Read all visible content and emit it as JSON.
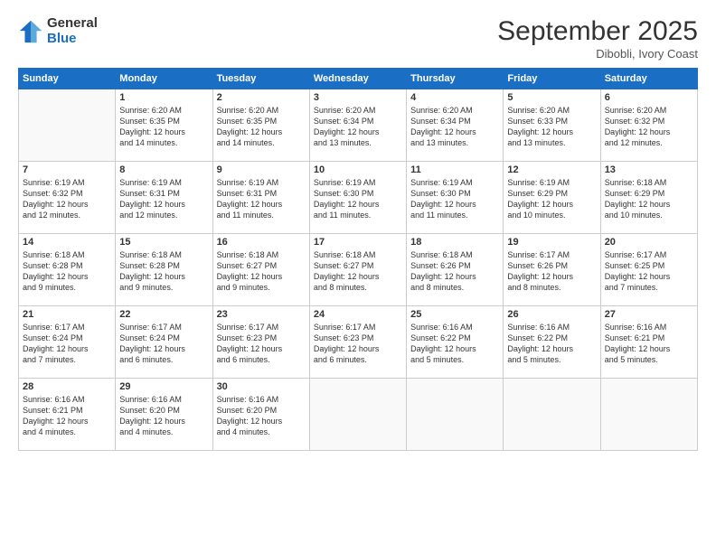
{
  "logo": {
    "general": "General",
    "blue": "Blue"
  },
  "header": {
    "title": "September 2025",
    "subtitle": "Dibobli, Ivory Coast"
  },
  "days_of_week": [
    "Sunday",
    "Monday",
    "Tuesday",
    "Wednesday",
    "Thursday",
    "Friday",
    "Saturday"
  ],
  "weeks": [
    [
      {
        "day": "",
        "info": ""
      },
      {
        "day": "1",
        "info": "Sunrise: 6:20 AM\nSunset: 6:35 PM\nDaylight: 12 hours\nand 14 minutes."
      },
      {
        "day": "2",
        "info": "Sunrise: 6:20 AM\nSunset: 6:35 PM\nDaylight: 12 hours\nand 14 minutes."
      },
      {
        "day": "3",
        "info": "Sunrise: 6:20 AM\nSunset: 6:34 PM\nDaylight: 12 hours\nand 13 minutes."
      },
      {
        "day": "4",
        "info": "Sunrise: 6:20 AM\nSunset: 6:34 PM\nDaylight: 12 hours\nand 13 minutes."
      },
      {
        "day": "5",
        "info": "Sunrise: 6:20 AM\nSunset: 6:33 PM\nDaylight: 12 hours\nand 13 minutes."
      },
      {
        "day": "6",
        "info": "Sunrise: 6:20 AM\nSunset: 6:32 PM\nDaylight: 12 hours\nand 12 minutes."
      }
    ],
    [
      {
        "day": "7",
        "info": "Sunrise: 6:19 AM\nSunset: 6:32 PM\nDaylight: 12 hours\nand 12 minutes."
      },
      {
        "day": "8",
        "info": "Sunrise: 6:19 AM\nSunset: 6:31 PM\nDaylight: 12 hours\nand 12 minutes."
      },
      {
        "day": "9",
        "info": "Sunrise: 6:19 AM\nSunset: 6:31 PM\nDaylight: 12 hours\nand 11 minutes."
      },
      {
        "day": "10",
        "info": "Sunrise: 6:19 AM\nSunset: 6:30 PM\nDaylight: 12 hours\nand 11 minutes."
      },
      {
        "day": "11",
        "info": "Sunrise: 6:19 AM\nSunset: 6:30 PM\nDaylight: 12 hours\nand 11 minutes."
      },
      {
        "day": "12",
        "info": "Sunrise: 6:19 AM\nSunset: 6:29 PM\nDaylight: 12 hours\nand 10 minutes."
      },
      {
        "day": "13",
        "info": "Sunrise: 6:18 AM\nSunset: 6:29 PM\nDaylight: 12 hours\nand 10 minutes."
      }
    ],
    [
      {
        "day": "14",
        "info": "Sunrise: 6:18 AM\nSunset: 6:28 PM\nDaylight: 12 hours\nand 9 minutes."
      },
      {
        "day": "15",
        "info": "Sunrise: 6:18 AM\nSunset: 6:28 PM\nDaylight: 12 hours\nand 9 minutes."
      },
      {
        "day": "16",
        "info": "Sunrise: 6:18 AM\nSunset: 6:27 PM\nDaylight: 12 hours\nand 9 minutes."
      },
      {
        "day": "17",
        "info": "Sunrise: 6:18 AM\nSunset: 6:27 PM\nDaylight: 12 hours\nand 8 minutes."
      },
      {
        "day": "18",
        "info": "Sunrise: 6:18 AM\nSunset: 6:26 PM\nDaylight: 12 hours\nand 8 minutes."
      },
      {
        "day": "19",
        "info": "Sunrise: 6:17 AM\nSunset: 6:26 PM\nDaylight: 12 hours\nand 8 minutes."
      },
      {
        "day": "20",
        "info": "Sunrise: 6:17 AM\nSunset: 6:25 PM\nDaylight: 12 hours\nand 7 minutes."
      }
    ],
    [
      {
        "day": "21",
        "info": "Sunrise: 6:17 AM\nSunset: 6:24 PM\nDaylight: 12 hours\nand 7 minutes."
      },
      {
        "day": "22",
        "info": "Sunrise: 6:17 AM\nSunset: 6:24 PM\nDaylight: 12 hours\nand 6 minutes."
      },
      {
        "day": "23",
        "info": "Sunrise: 6:17 AM\nSunset: 6:23 PM\nDaylight: 12 hours\nand 6 minutes."
      },
      {
        "day": "24",
        "info": "Sunrise: 6:17 AM\nSunset: 6:23 PM\nDaylight: 12 hours\nand 6 minutes."
      },
      {
        "day": "25",
        "info": "Sunrise: 6:16 AM\nSunset: 6:22 PM\nDaylight: 12 hours\nand 5 minutes."
      },
      {
        "day": "26",
        "info": "Sunrise: 6:16 AM\nSunset: 6:22 PM\nDaylight: 12 hours\nand 5 minutes."
      },
      {
        "day": "27",
        "info": "Sunrise: 6:16 AM\nSunset: 6:21 PM\nDaylight: 12 hours\nand 5 minutes."
      }
    ],
    [
      {
        "day": "28",
        "info": "Sunrise: 6:16 AM\nSunset: 6:21 PM\nDaylight: 12 hours\nand 4 minutes."
      },
      {
        "day": "29",
        "info": "Sunrise: 6:16 AM\nSunset: 6:20 PM\nDaylight: 12 hours\nand 4 minutes."
      },
      {
        "day": "30",
        "info": "Sunrise: 6:16 AM\nSunset: 6:20 PM\nDaylight: 12 hours\nand 4 minutes."
      },
      {
        "day": "",
        "info": ""
      },
      {
        "day": "",
        "info": ""
      },
      {
        "day": "",
        "info": ""
      },
      {
        "day": "",
        "info": ""
      }
    ]
  ]
}
